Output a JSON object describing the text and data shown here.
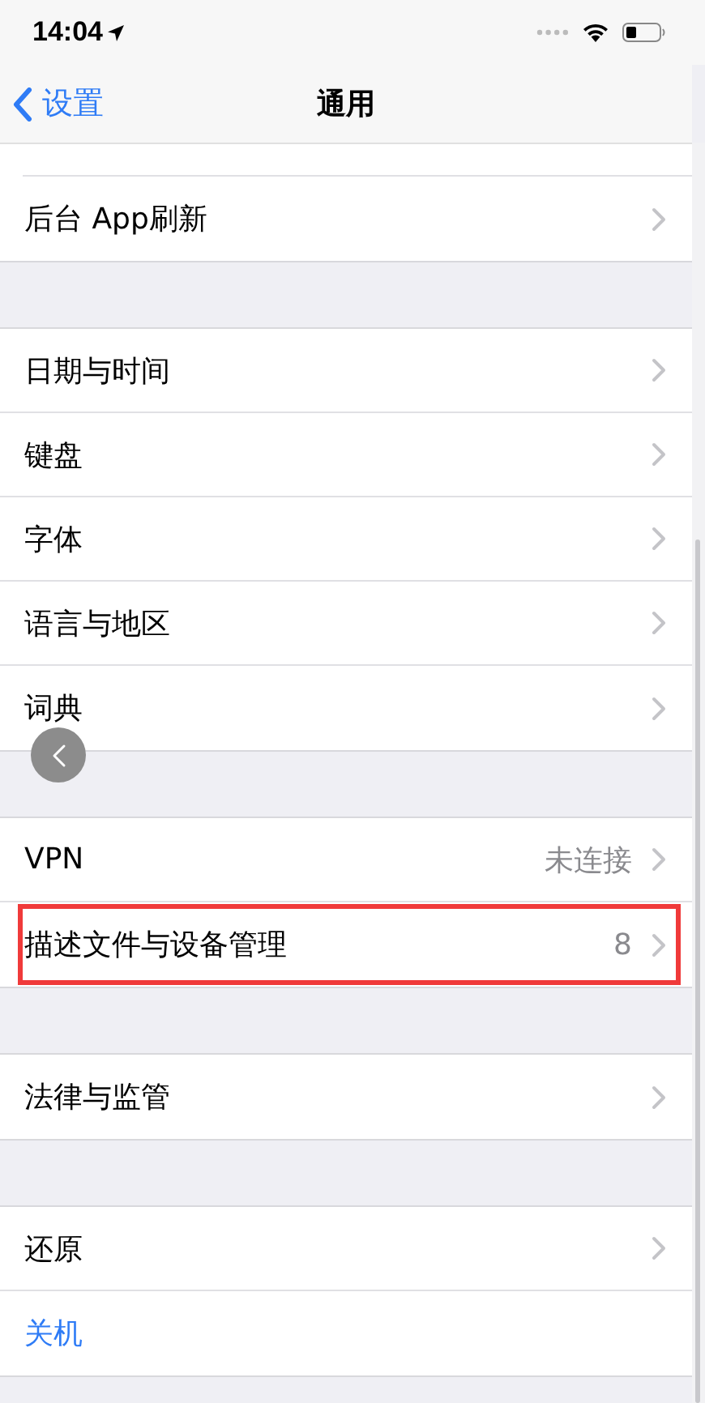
{
  "status_bar": {
    "time": "14:04"
  },
  "nav_bar": {
    "back_label": "设置",
    "title": "通用"
  },
  "groups": [
    {
      "partial_top": true,
      "rows": [
        {
          "kind": "link",
          "label": "后台 App刷新",
          "highlighted": false
        }
      ]
    },
    {
      "rows": [
        {
          "kind": "link",
          "label": "日期与时间",
          "highlighted": false
        },
        {
          "kind": "link",
          "label": "键盘",
          "highlighted": false
        },
        {
          "kind": "link",
          "label": "字体",
          "highlighted": false
        },
        {
          "kind": "link",
          "label": "语言与地区",
          "highlighted": false
        },
        {
          "kind": "link",
          "label": "词典",
          "highlighted": false
        }
      ]
    },
    {
      "rows": [
        {
          "kind": "link",
          "label": "VPN",
          "value": "未连接",
          "highlighted": false
        },
        {
          "kind": "link",
          "label": "描述文件与设备管理",
          "value": "8",
          "highlighted": true
        }
      ]
    },
    {
      "rows": [
        {
          "kind": "link",
          "label": "法律与监管",
          "highlighted": false
        }
      ]
    },
    {
      "rows": [
        {
          "kind": "link",
          "label": "还原",
          "highlighted": false
        },
        {
          "kind": "action",
          "label": "关机",
          "highlighted": false
        }
      ]
    }
  ]
}
